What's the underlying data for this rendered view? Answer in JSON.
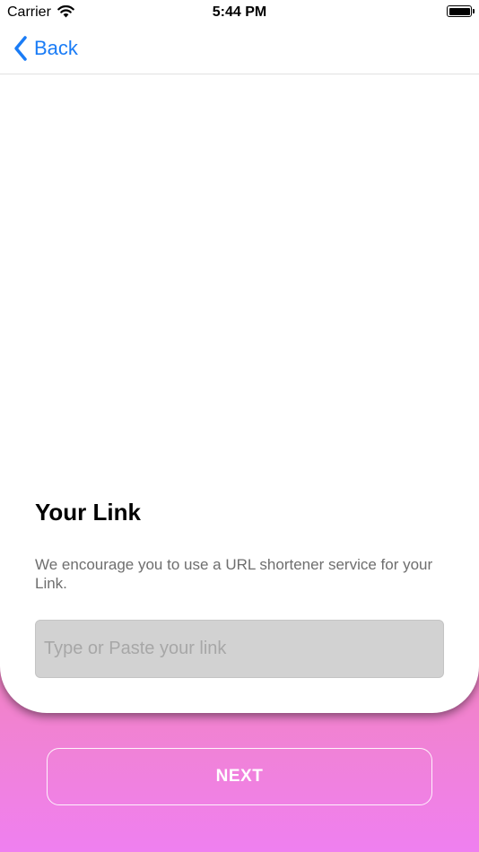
{
  "status_bar": {
    "carrier": "Carrier",
    "time": "5:44 PM"
  },
  "nav": {
    "back_label": "Back"
  },
  "card": {
    "title": "Your Link",
    "description": "We encourage you to use a URL shortener service for your Link.",
    "input": {
      "placeholder": "Type or Paste your link",
      "value": ""
    }
  },
  "footer": {
    "next_label": "NEXT"
  },
  "colors": {
    "accent": "#1a7cf6",
    "gradient_top": "#f98e50",
    "gradient_bottom": "#ef80f0",
    "input_bg": "#d2d2d2"
  },
  "icons": {
    "back": "chevron-left-icon",
    "wifi": "wifi-icon",
    "battery": "battery-icon"
  }
}
